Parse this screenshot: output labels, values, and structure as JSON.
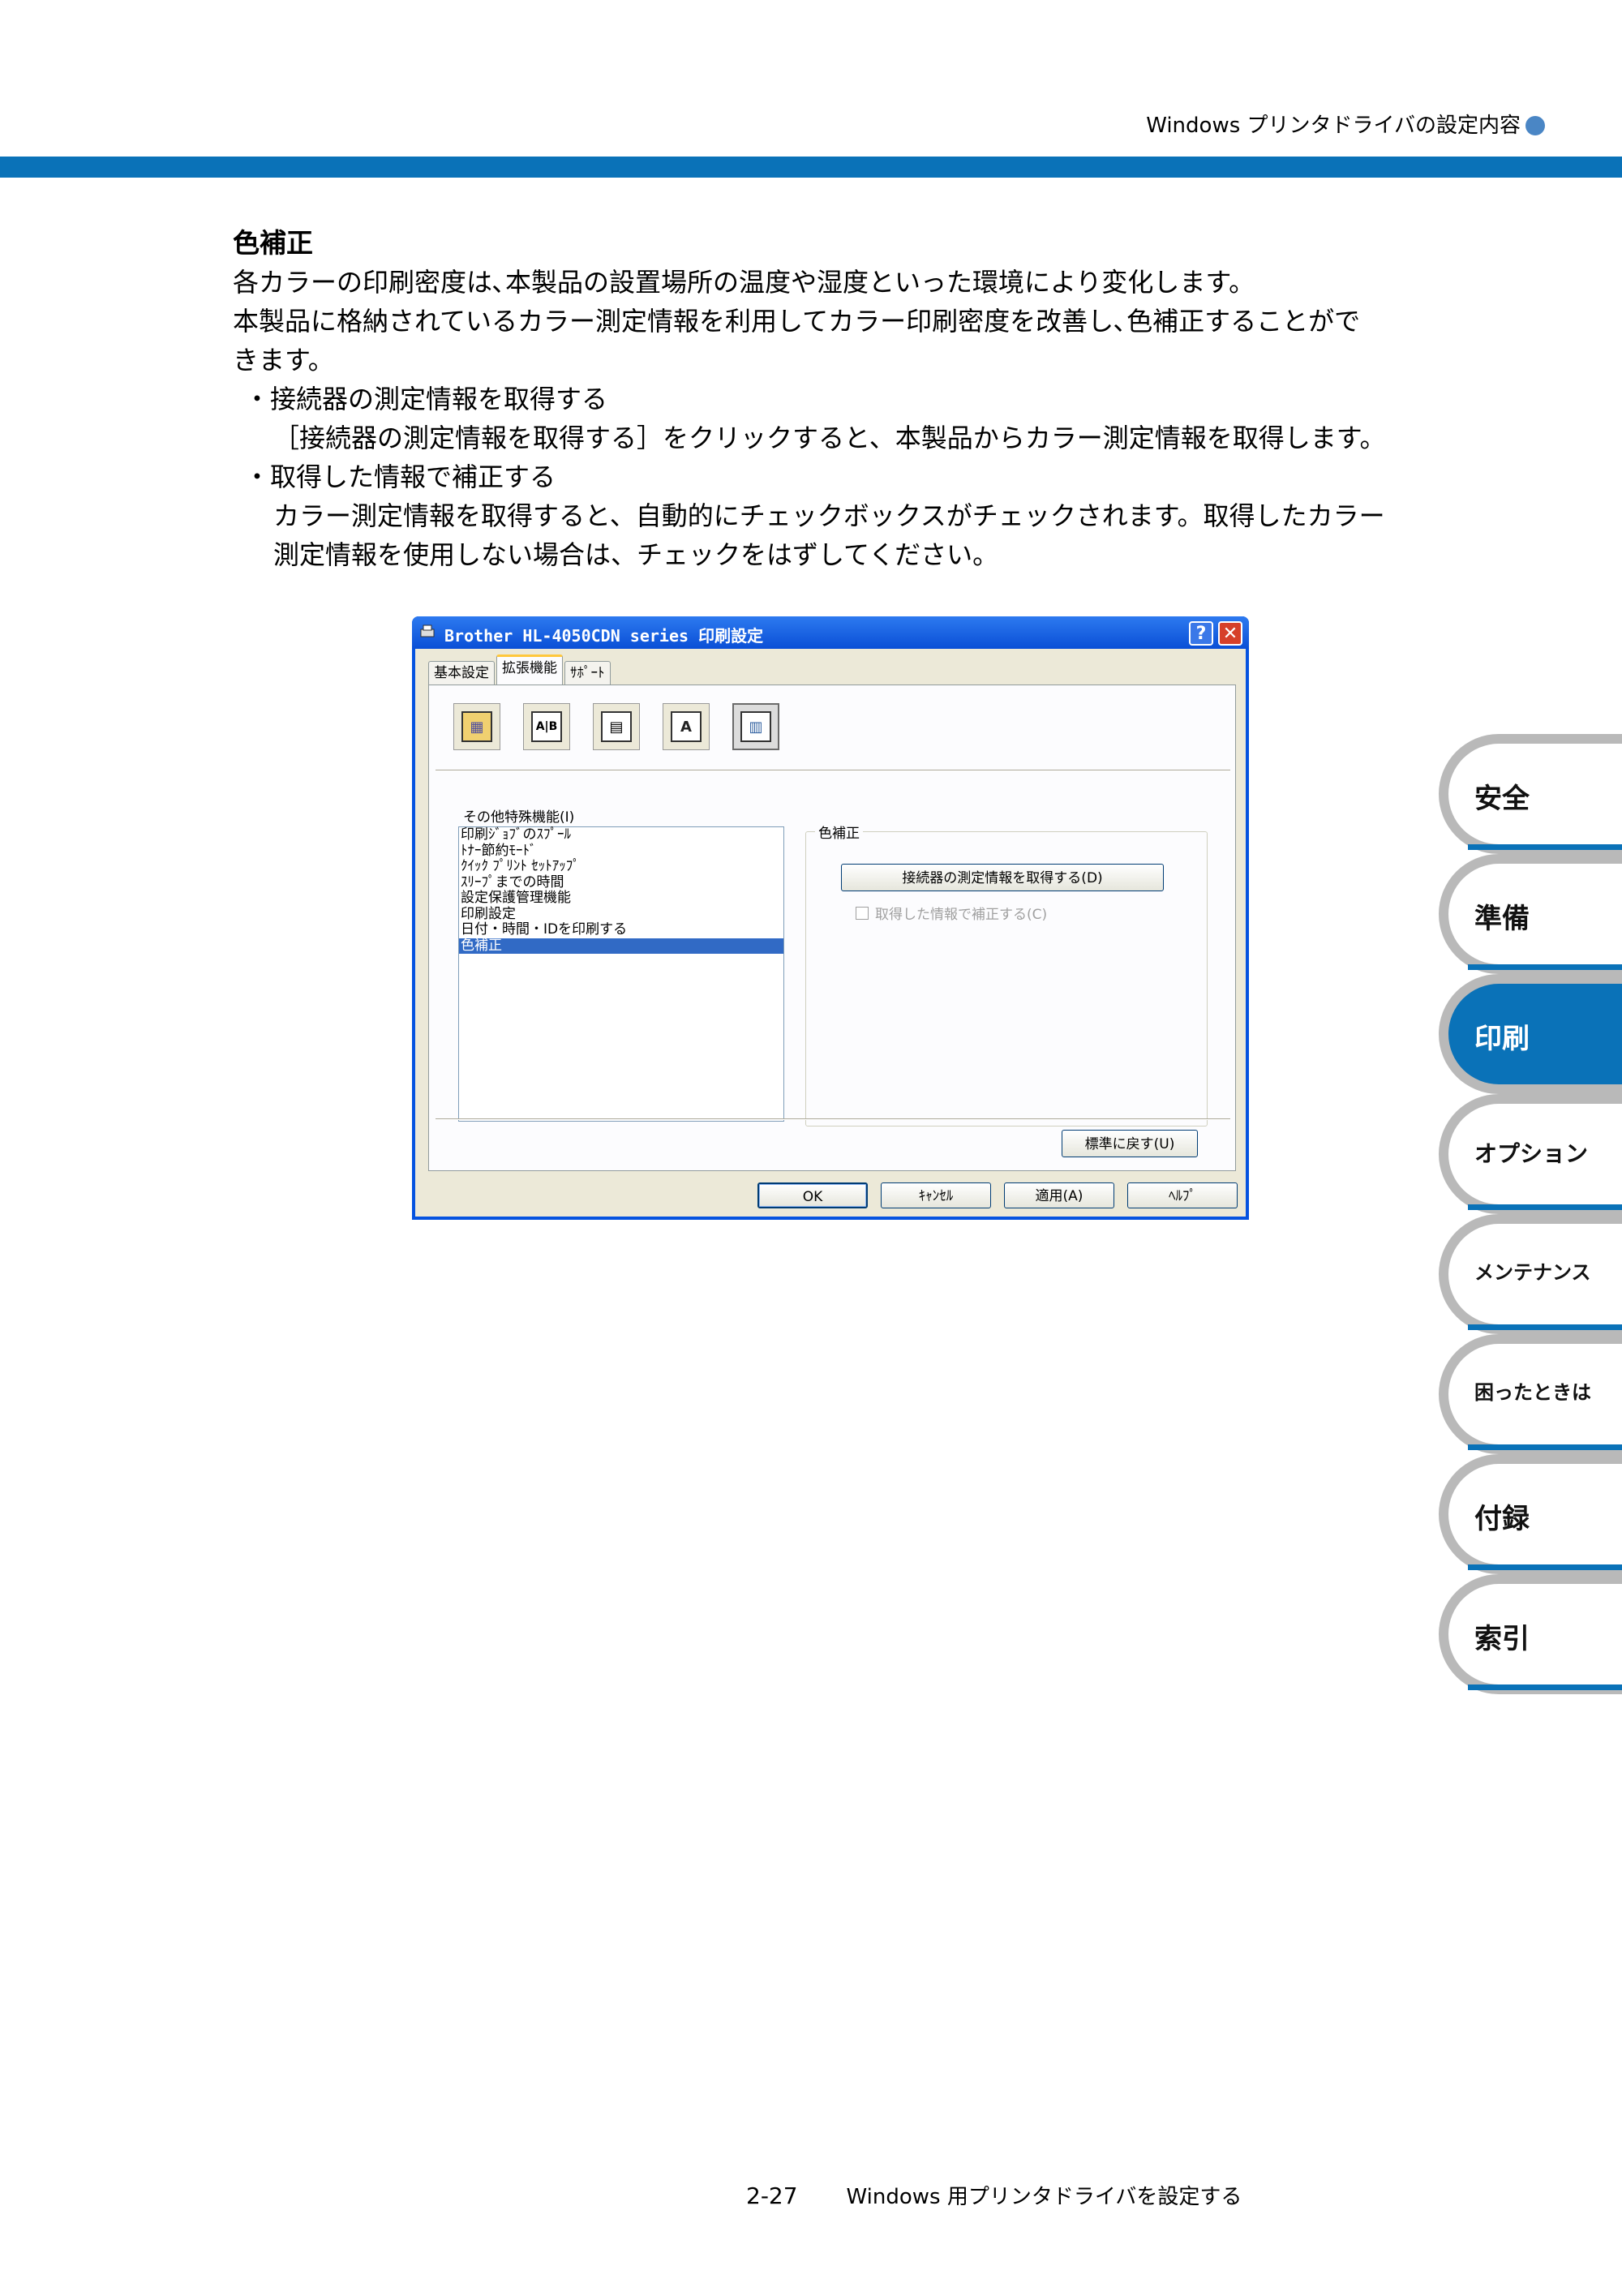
{
  "header": {
    "title": "Windows プリンタドライバの設定内容"
  },
  "content": {
    "section_title": "色補正",
    "para1": "各カラーの印刷密度は､本製品の設置場所の温度や湿度といった環境により変化します。",
    "para2a": "本製品に格納されているカラー測定情報を利用してカラー印刷密度を改善し､色補正することがで",
    "para2b": "きます。",
    "bullets": [
      {
        "label": "・接続器の測定情報を取得する",
        "desc1": "［接続器の測定情報を取得する］をクリックすると、本製品からカラー測定情報を取得します。",
        "desc2": ""
      },
      {
        "label": "・取得した情報で補正する",
        "desc1": "カラー測定情報を取得すると、自動的にチェックボックスがチェックされます。取得したカラー",
        "desc2": "測定情報を使用しない場合は、チェックをはずしてください。"
      }
    ]
  },
  "dialog": {
    "title": "Brother HL-4050CDN series 印刷設定",
    "help_glyph": "?",
    "close_glyph": "✕",
    "tabs": [
      "基本設定",
      "拡張機能",
      "ｻﾎﾟｰﾄ"
    ],
    "icons": [
      "watermark-icon",
      "multiple-page-icon",
      "copy-icon",
      "font-icon",
      "other-settings-icon"
    ],
    "icon_glyphs": [
      "▦",
      "A|B",
      "▤",
      "A",
      "▥"
    ],
    "list_label": "その他特殊機能(I)",
    "list_items": [
      "印刷ｼﾞｮﾌﾞのｽﾌﾟｰﾙ",
      "ﾄﾅｰ節約ﾓｰﾄﾞ",
      "ｸｲｯｸ ﾌﾟﾘﾝﾄ ｾｯﾄｱｯﾌﾟ",
      "ｽﾘｰﾌﾟまでの時間",
      "設定保護管理機能",
      "印刷設定",
      "日付・時間・IDを印刷する",
      "色補正"
    ],
    "selected_index": 7,
    "group_label": "色補正",
    "calibration_button": "接続器の測定情報を取得する(D)",
    "checkbox_label": "取得した情報で補正する(C)",
    "reset_button": "標準に戻す(U)",
    "ok_button": "OK",
    "cancel_button": "ｷｬﾝｾﾙ",
    "apply_button": "適用(A)",
    "help_button": "ﾍﾙﾌﾟ"
  },
  "side_tabs": [
    "安全",
    "準備",
    "印刷",
    "オプション",
    "メンテナンス",
    "困ったときは",
    "付録",
    "索引"
  ],
  "side_tabs_active": "印刷",
  "footer": {
    "page": "2-27",
    "title": "Windows 用プリンタドライバを設定する"
  },
  "colors": {
    "accent_blue": "#0a72b8",
    "title_bar": "#0a4fd6",
    "list_selection": "#316ac5"
  }
}
